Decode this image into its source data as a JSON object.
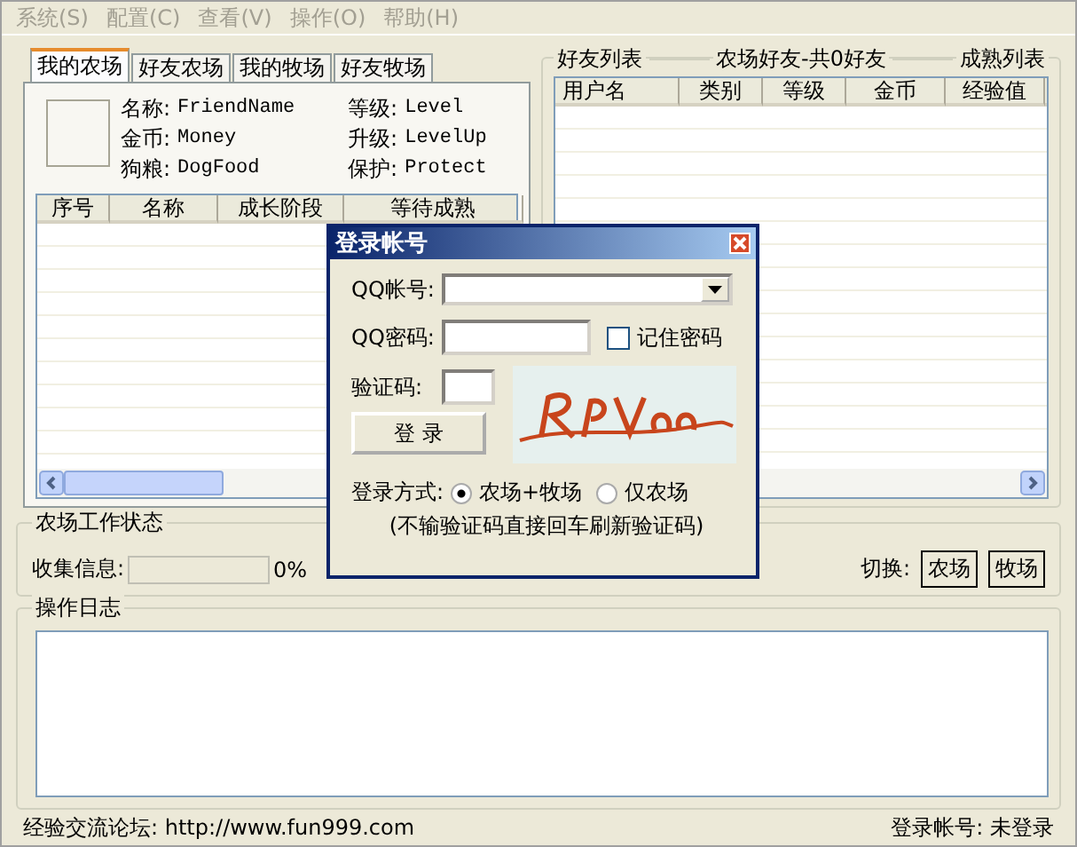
{
  "menu": [
    {
      "label": "系统(S)",
      "disabled": true
    },
    {
      "label": "配置(C)",
      "disabled": true
    },
    {
      "label": "查看(V)",
      "disabled": true
    },
    {
      "label": "操作(O)",
      "disabled": true
    },
    {
      "label": "帮助(H)",
      "disabled": true
    }
  ],
  "farm_tabs": [
    {
      "label": "我的农场",
      "selected": true
    },
    {
      "label": "好友农场",
      "selected": false
    },
    {
      "label": "我的牧场",
      "selected": false
    },
    {
      "label": "好友牧场",
      "selected": false
    }
  ],
  "farm_info": [
    {
      "label": "名称:",
      "value": "FriendName"
    },
    {
      "label": "等级:",
      "value": "Level"
    },
    {
      "label": "金币:",
      "value": "Money"
    },
    {
      "label": "升级:",
      "value": "LevelUp"
    },
    {
      "label": "狗粮:",
      "value": "DogFood"
    },
    {
      "label": "保护:",
      "value": "Protect"
    }
  ],
  "farm_table": {
    "columns": [
      "序号",
      "名称",
      "成长阶段",
      "等待成熟"
    ]
  },
  "friends_panel": {
    "titles": [
      "好友列表",
      "农场好友-共0好友",
      "成熟列表"
    ],
    "columns": [
      "用户名",
      "类别",
      "等级",
      "金币",
      "经验值"
    ]
  },
  "status_group": {
    "title": "农场工作状态",
    "collect_label": "收集信息:",
    "progress": {
      "level": 0,
      "reading": "0%"
    },
    "switch_label": "切换:",
    "switch_buttons": [
      "农场",
      "牧场"
    ]
  },
  "log": {
    "title": "操作日志"
  },
  "footer": {
    "forum": "经验交流论坛: http://www.fun999.com",
    "account": "登录帐号: 未登录"
  },
  "dialog": {
    "title": "登录帐号",
    "qq_label": "QQ帐号:",
    "password_label": "QQ密码:",
    "remember": {
      "label": "记住密码",
      "checked": false
    },
    "captcha_label": "验证码:",
    "login_button": "登 录",
    "mode_label": "登录方式:",
    "modes": [
      {
        "label": "农场+牧场",
        "selected": true
      },
      {
        "label": "仅农场",
        "selected": false
      }
    ],
    "hint": "(不输验证码直接回车刷新验证码)"
  }
}
